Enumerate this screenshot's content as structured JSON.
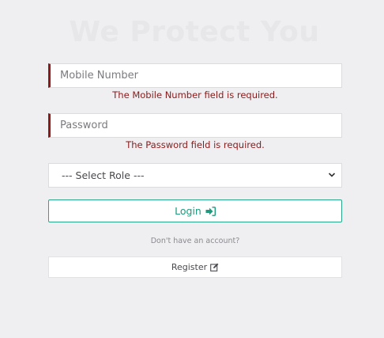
{
  "header": {
    "title": "We Protect You"
  },
  "form": {
    "mobile": {
      "placeholder": "Mobile Number",
      "value": "",
      "error": "The Mobile Number field is required."
    },
    "password": {
      "placeholder": "Password",
      "value": "",
      "error": "The Password field is required."
    },
    "role": {
      "selected": "--- Select Role ---"
    },
    "login_label": "Login",
    "no_account_text": "Don't have an account?",
    "register_label": "Register"
  },
  "colors": {
    "error": "#8b1a1a",
    "accent": "#1e9a7e",
    "background": "#efeff2"
  },
  "icons": {
    "login": "sign-in-icon",
    "register": "edit-icon",
    "select": "chevron-down-icon"
  }
}
